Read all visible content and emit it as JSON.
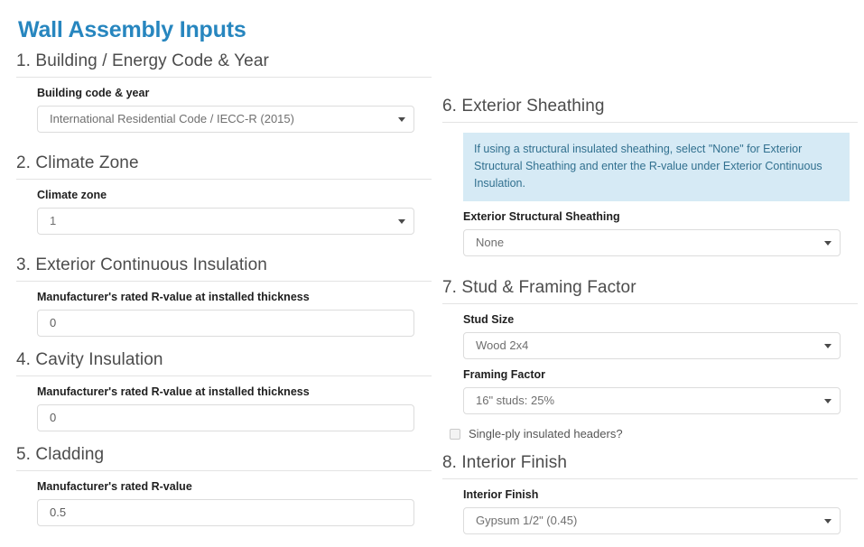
{
  "page": {
    "title": "Wall Assembly Inputs",
    "title_color": "#2786bf"
  },
  "left_column": {
    "sections": [
      {
        "heading": "1. Building / Energy Code & Year",
        "fields": [
          {
            "label": "Building code & year",
            "type": "select",
            "value": "International Residential Code / IECC-R (2015)"
          }
        ]
      },
      {
        "heading": "2. Climate Zone",
        "fields": [
          {
            "label": "Climate zone",
            "type": "select",
            "value": "1"
          }
        ]
      },
      {
        "heading": "3. Exterior Continuous Insulation",
        "fields": [
          {
            "label": "Manufacturer's rated R-value at installed thickness",
            "type": "input",
            "value": "0"
          }
        ]
      },
      {
        "heading": "4. Cavity Insulation",
        "fields": [
          {
            "label": "Manufacturer's rated R-value at installed thickness",
            "type": "input",
            "value": "0"
          }
        ]
      },
      {
        "heading": "5. Cladding",
        "fields": [
          {
            "label": "Manufacturer's rated R-value",
            "type": "input",
            "value": "0.5"
          }
        ]
      }
    ]
  },
  "right_column": {
    "sections": [
      {
        "heading": "6. Exterior Sheathing",
        "info_text": "If using a structural insulated sheathing, select \"None\" for Exterior Structural Sheathing and enter the R-value under Exterior Continuous Insulation.",
        "info_bg": "#d6eaf5",
        "info_color": "#31708f",
        "fields": [
          {
            "label": "Exterior Structural Sheathing",
            "type": "select",
            "value": "None"
          }
        ]
      },
      {
        "heading": "7. Stud & Framing Factor",
        "fields": [
          {
            "label": "Stud Size",
            "type": "select",
            "value": "Wood 2x4"
          },
          {
            "label": "Framing Factor",
            "type": "select",
            "value": "16\" studs: 25%"
          }
        ],
        "checkbox": {
          "label": "Single-ply insulated headers?",
          "checked": false
        }
      },
      {
        "heading": "8. Interior Finish",
        "fields": [
          {
            "label": "Interior Finish",
            "type": "select",
            "value": "Gypsum 1/2\" (0.45)"
          }
        ]
      }
    ]
  }
}
